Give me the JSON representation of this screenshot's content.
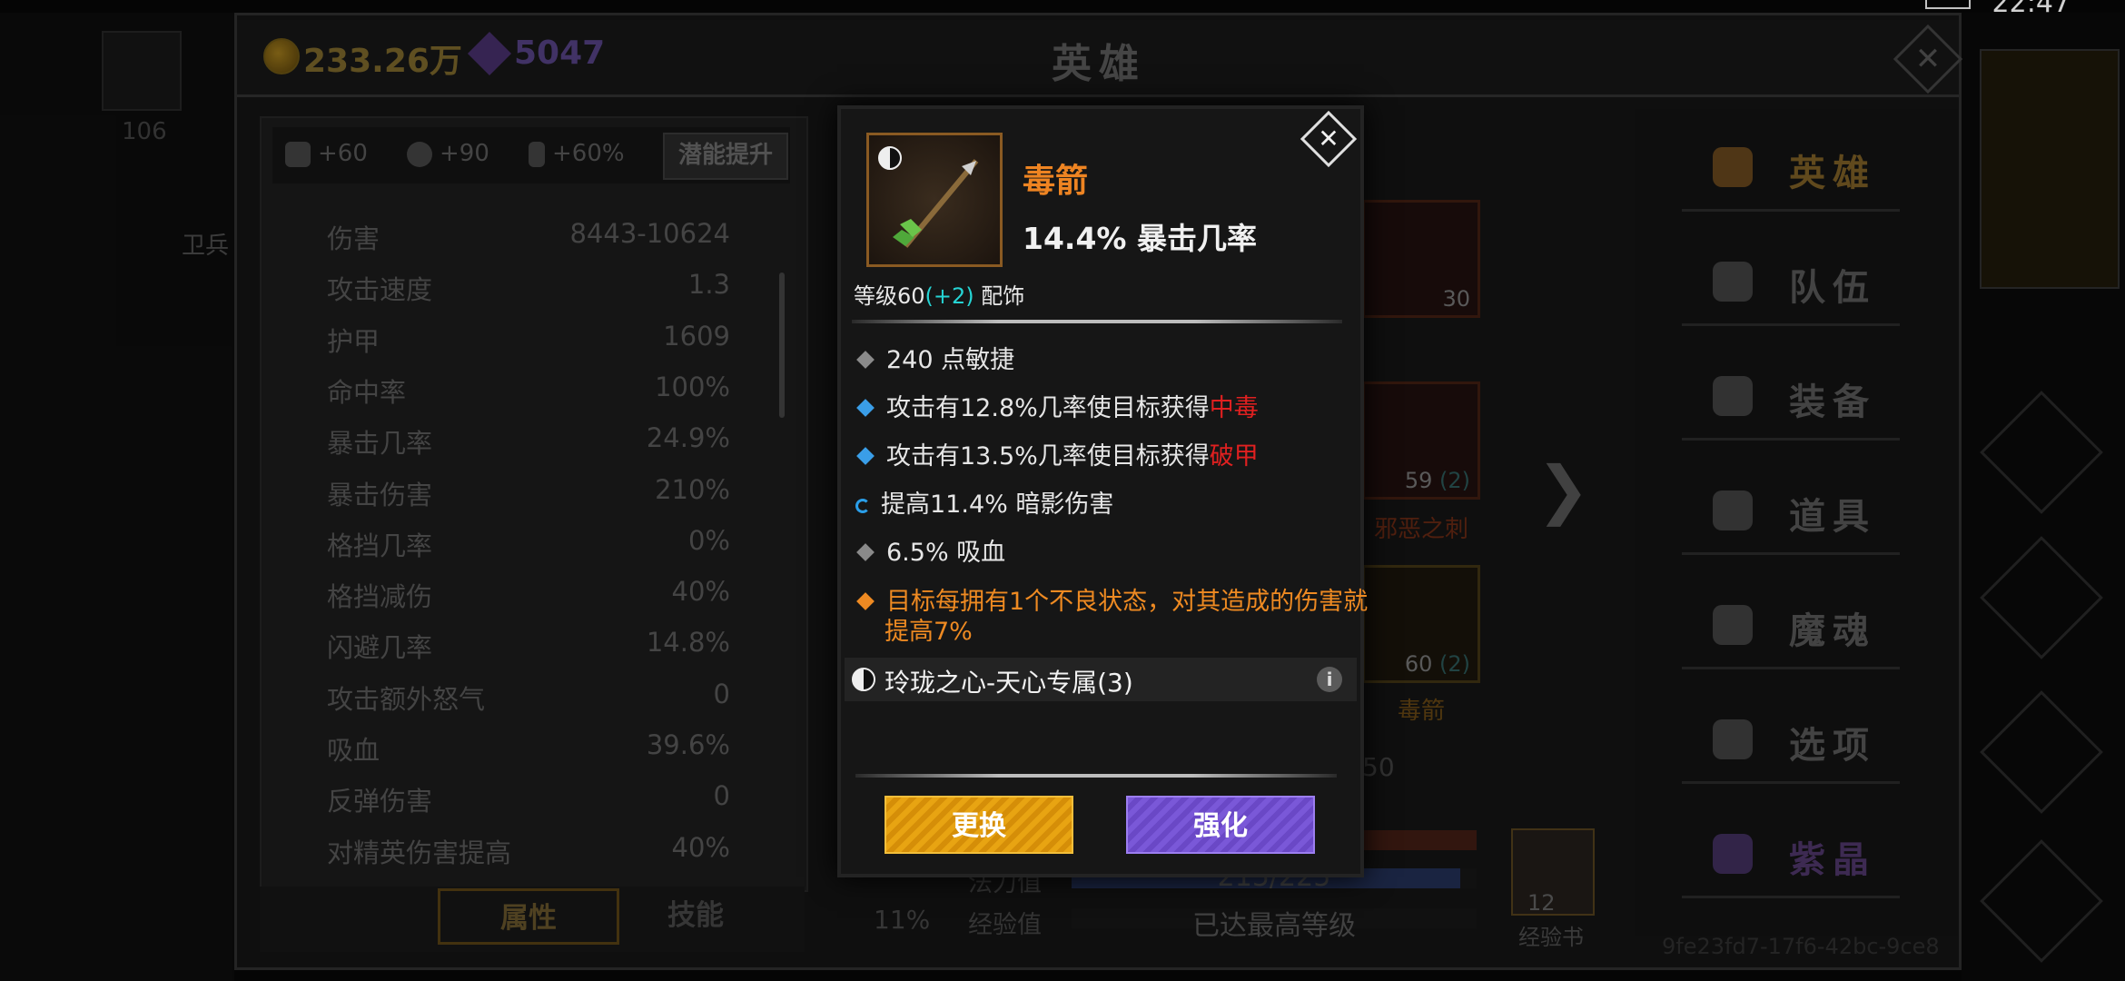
{
  "status_bar": {
    "time": "22:47"
  },
  "currency": {
    "gold": "233.26万",
    "gems": "5047"
  },
  "header": {
    "title": "英雄"
  },
  "background_left": {
    "hero_level": "106",
    "unit_label": "卫兵"
  },
  "stats": {
    "bonuses": [
      {
        "icon": "strength-icon",
        "value": "+60"
      },
      {
        "icon": "heart-icon",
        "value": "+90"
      },
      {
        "icon": "lightning-icon",
        "value": "+60%"
      }
    ],
    "potential_button": "潜能提升",
    "rows": [
      {
        "label": "伤害",
        "value": "8443-10624"
      },
      {
        "label": "攻击速度",
        "value": "1.3"
      },
      {
        "label": "护甲",
        "value": "1609"
      },
      {
        "label": "命中率",
        "value": "100%"
      },
      {
        "label": "暴击几率",
        "value": "24.9%"
      },
      {
        "label": "暴击伤害",
        "value": "210%"
      },
      {
        "label": "格挡几率",
        "value": "0%"
      },
      {
        "label": "格挡减伤",
        "value": "40%"
      },
      {
        "label": "闪避几率",
        "value": "14.8%"
      },
      {
        "label": "攻击额外怒气",
        "value": "0"
      },
      {
        "label": "吸血",
        "value": "39.6%"
      },
      {
        "label": "反弹伤害",
        "value": "0"
      },
      {
        "label": "对精英伤害提高",
        "value": "40%"
      }
    ]
  },
  "tabs": {
    "attributes": "属性",
    "skills": "技能"
  },
  "equipment": {
    "armor_level": "30",
    "boots": {
      "level": "59",
      "bonus": "(2)",
      "name": "邪恶之刺"
    },
    "arrow": {
      "level": "60",
      "bonus": "(2)",
      "name": "毒箭"
    },
    "partial_text": "50"
  },
  "hero_bars": {
    "percent": "11%",
    "mana_label": "法力值",
    "mana_value": "215/225",
    "exp_label": "经验值",
    "exp_value": "已达最高等级"
  },
  "exp_book": {
    "count": "12",
    "label": "经验书"
  },
  "user_id": "9fe23fd7-17f6-42bc-9ce8",
  "menu": {
    "items": [
      {
        "label": "英雄",
        "icon": "people-icon"
      },
      {
        "label": "队伍",
        "icon": "flag-icon"
      },
      {
        "label": "装备",
        "icon": "helmet-icon"
      },
      {
        "label": "道具",
        "icon": "bag-icon"
      },
      {
        "label": "魔魂",
        "icon": "flame-icon"
      },
      {
        "label": "选项",
        "icon": "gear-icon"
      },
      {
        "label": "紫晶",
        "icon": "crystal-icon"
      }
    ]
  },
  "item_popup": {
    "name": "毒箭",
    "main_stat": "14.4% 暴击几率",
    "level_prefix": "等级60",
    "level_bonus": "(+2)",
    "slot": "配饰",
    "affixes": [
      {
        "prefix": "240 点敏捷",
        "highlight": "",
        "bullet": "#8a8a8a",
        "style": "normal"
      },
      {
        "prefix": "攻击有12.8%几率使目标获得",
        "highlight": "中毒",
        "bullet": "#3a9ee8",
        "style": "normal"
      },
      {
        "prefix": "攻击有13.5%几率使目标获得",
        "highlight": "破甲",
        "bullet": "#3a9ee8",
        "style": "normal"
      },
      {
        "prefix": "提高11.4% 暗影伤害",
        "highlight": "",
        "bullet": "#2a9ee8",
        "style": "refresh"
      },
      {
        "prefix": "6.5% 吸血",
        "highlight": "",
        "bullet": "#8a8a8a",
        "style": "normal"
      },
      {
        "prefix": "目标每拥有1个不良状态，对其造成的伤害就提高7%",
        "highlight": "",
        "bullet": "#ee8a22",
        "style": "orange"
      }
    ],
    "set_name": "玲珑之心-天心专属(3)",
    "replace_button": "更换",
    "enhance_button": "强化"
  },
  "colors": {
    "gold": "#ee8422",
    "crit_red": "#e02020",
    "cyan_bonus": "#26d4d4",
    "replace_btn": "#e8a412",
    "enhance_btn": "#7a58d8"
  }
}
